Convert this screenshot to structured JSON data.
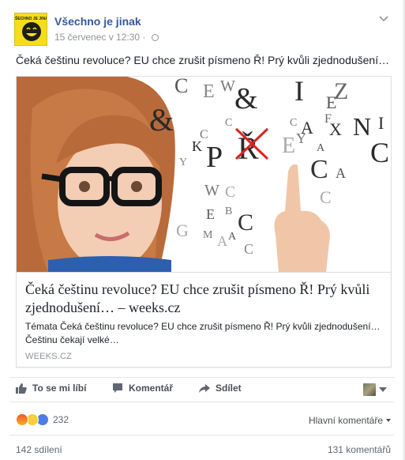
{
  "post": {
    "page_name": "Všechno je jinak",
    "timestamp": "15 červenec v 12:30",
    "separator": "·",
    "text": "Čeká češtinu revoluce? EU chce zrušit písmeno Ř! Prý kvůli zjednodušení…",
    "avatar_logo_text": "VŠECHNO JE JINAK"
  },
  "link_card": {
    "title": "Čeká češtinu revoluce? EU chce zrušit písmeno Ř! Prý kvůli zjednodušení… – weeks.cz",
    "description": "Témata Čeká češtinu revoluce? EU chce zrušit písmeno Ř! Prý kvůli zjednodušení… Češtinu čekají velké…",
    "domain": "WEEKS.CZ",
    "image_letters": [
      "&",
      "C",
      "E",
      "W",
      "&",
      "I",
      "E",
      "Z",
      "F",
      "N",
      "I",
      "&",
      "C",
      "P",
      "Ř",
      "K",
      "Y",
      "X",
      "C",
      "A",
      "F",
      "O",
      "Y",
      "C",
      "H",
      "C",
      "A",
      "W",
      "C",
      "E",
      "B",
      "C",
      "G",
      "M",
      "A",
      "C",
      "Y",
      "C"
    ]
  },
  "actions": {
    "like_label": "To se mi líbí",
    "comment_label": "Komentář",
    "share_label": "Sdílet"
  },
  "reactions": {
    "count": "232",
    "sort_label": "Hlavní komentáře"
  },
  "footer": {
    "shares": "142 sdílení",
    "comments": "131 komentářů"
  },
  "colors": {
    "link_blue": "#365899",
    "text": "#1d2129",
    "meta": "#90949c",
    "action": "#4b4f56"
  }
}
